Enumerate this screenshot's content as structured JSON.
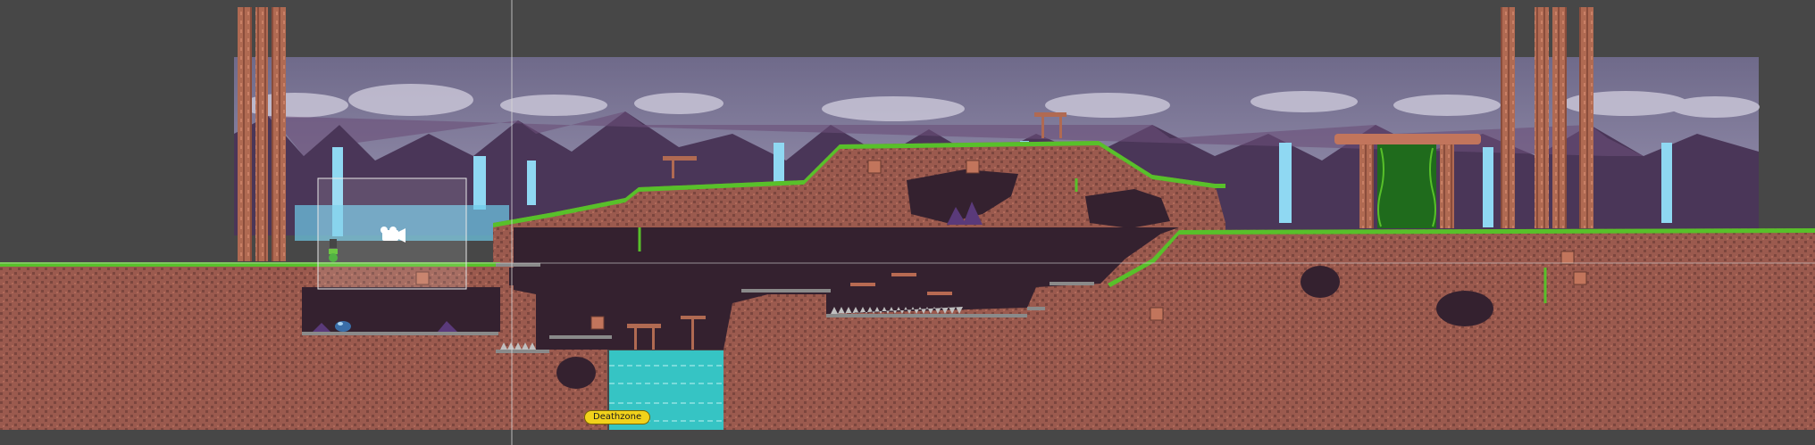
{
  "labels": {
    "deathzone": "Deathzone"
  },
  "colors": {
    "editor_background": "#474747",
    "sky": "#8d86a8",
    "sky_top": "#6f6a8a",
    "cloud": "#c8c4d6",
    "mountain_dark": "#3a2c46",
    "mountain_light": "#6b4f78",
    "waterfall": "#8fd8f2",
    "dirt": "#9b5a4e",
    "dirt_dark": "#7c463e",
    "grass": "#58c02a",
    "cave": "#34212f",
    "water": "#36c4c4",
    "tree_trunk": "#b06a52",
    "vine_door": "#1f6b1c",
    "deathzone_badge": "#f2d21b",
    "stone": "#8a8a8a"
  },
  "icons": {
    "player": "player-character-icon",
    "camera_gizmo": "camera-gizmo-icon",
    "slime_enemy": "slime-enemy-icon",
    "goal_door": "vine-door-icon",
    "sign": "wooden-signpost-icon",
    "spikes": "floor-spikes-icon"
  }
}
